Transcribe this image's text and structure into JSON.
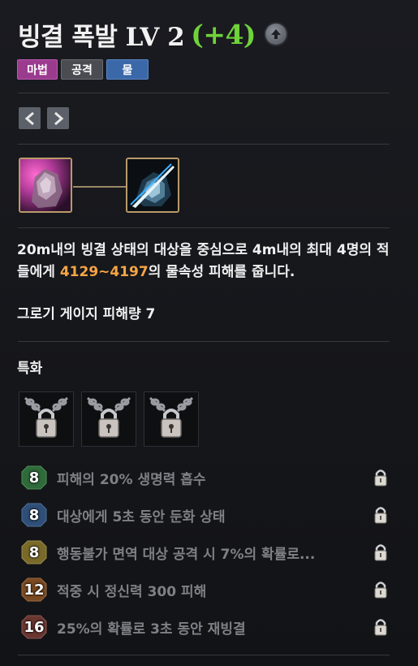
{
  "skill": {
    "name": "빙결 폭발 LV 2",
    "bonus": "(+4)",
    "tags": [
      "마법",
      "공격",
      "물"
    ]
  },
  "description": {
    "part1": "20m내의 빙결 상태의 대상을 중심으로 4m내의 최대 4명의 적들에게 ",
    "damage": "4129~4197",
    "part2": "의 물속성 피해를 줍니다."
  },
  "gauge": "그로기 게이지 피해량 7",
  "specialization": {
    "title": "특화"
  },
  "tripods": [
    {
      "level": "8",
      "text": "피해의 20% 생명력 흡수",
      "color": "#2f6a3a"
    },
    {
      "level": "8",
      "text": "대상에게 5초 동안 둔화 상태",
      "color": "#2f4f78"
    },
    {
      "level": "8",
      "text": "행동불가 면역 대상 공격 시 7%의 확률로...",
      "color": "#7a6a2a"
    },
    {
      "level": "12",
      "text": "적중 시 정신력 300 피해",
      "color": "#7a4a22"
    },
    {
      "level": "16",
      "text": "25%의 확률로 3초 동안 재빙결",
      "color": "#6a3630"
    }
  ],
  "icons": {
    "upgrade": "arrow-up-circle-icon",
    "prev": "chevron-left-icon",
    "next": "chevron-right-icon",
    "lock": "padlock-icon"
  }
}
